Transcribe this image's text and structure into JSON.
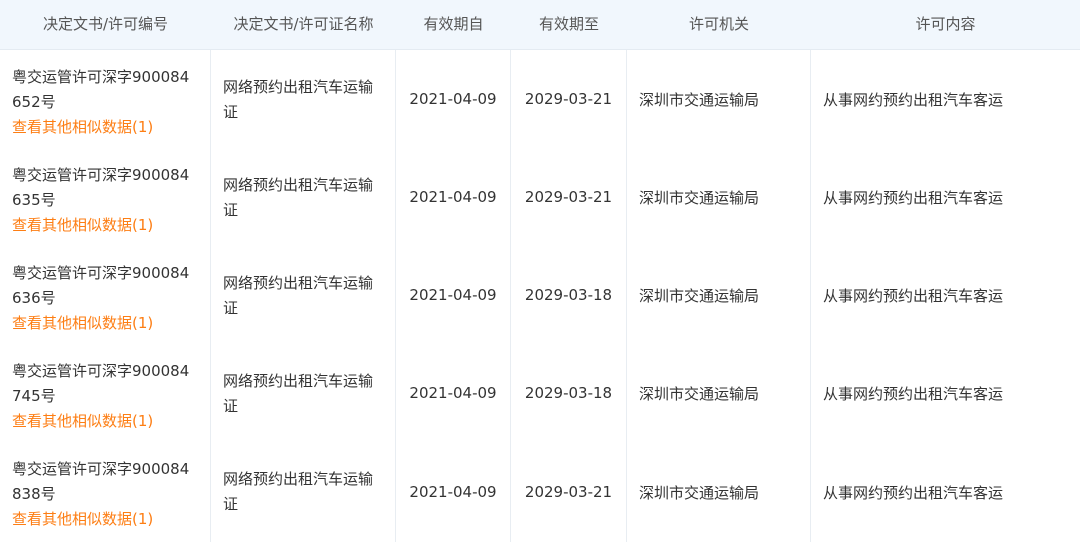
{
  "table": {
    "headers": [
      "决定文书/许可编号",
      "决定文书/许可证名称",
      "有效期自",
      "有效期至",
      "许可机关",
      "许可内容"
    ],
    "similar_link": "查看其他相似数据(1)",
    "rows": [
      {
        "code1": "粤交运管许可深字900084",
        "code2": "652号",
        "name1": "网络预约出租汽车运输",
        "name2": "证",
        "from": "2021-04-09",
        "to": "2029-03-21",
        "authority": "深圳市交通运输局",
        "content": "从事网约预约出租汽车客运"
      },
      {
        "code1": "粤交运管许可深字900084",
        "code2": "635号",
        "name1": "网络预约出租汽车运输",
        "name2": "证",
        "from": "2021-04-09",
        "to": "2029-03-21",
        "authority": "深圳市交通运输局",
        "content": "从事网约预约出租汽车客运"
      },
      {
        "code1": "粤交运管许可深字900084",
        "code2": "636号",
        "name1": "网络预约出租汽车运输",
        "name2": "证",
        "from": "2021-04-09",
        "to": "2029-03-18",
        "authority": "深圳市交通运输局",
        "content": "从事网约预约出租汽车客运"
      },
      {
        "code1": "粤交运管许可深字900084",
        "code2": "745号",
        "name1": "网络预约出租汽车运输",
        "name2": "证",
        "from": "2021-04-09",
        "to": "2029-03-18",
        "authority": "深圳市交通运输局",
        "content": "从事网约预约出租汽车客运"
      },
      {
        "code1": "粤交运管许可深字900084",
        "code2": "838号",
        "name1": "网络预约出租汽车运输",
        "name2": "证",
        "from": "2021-04-09",
        "to": "2029-03-21",
        "authority": "深圳市交通运输局",
        "content": "从事网约预约出租汽车客运"
      }
    ]
  }
}
